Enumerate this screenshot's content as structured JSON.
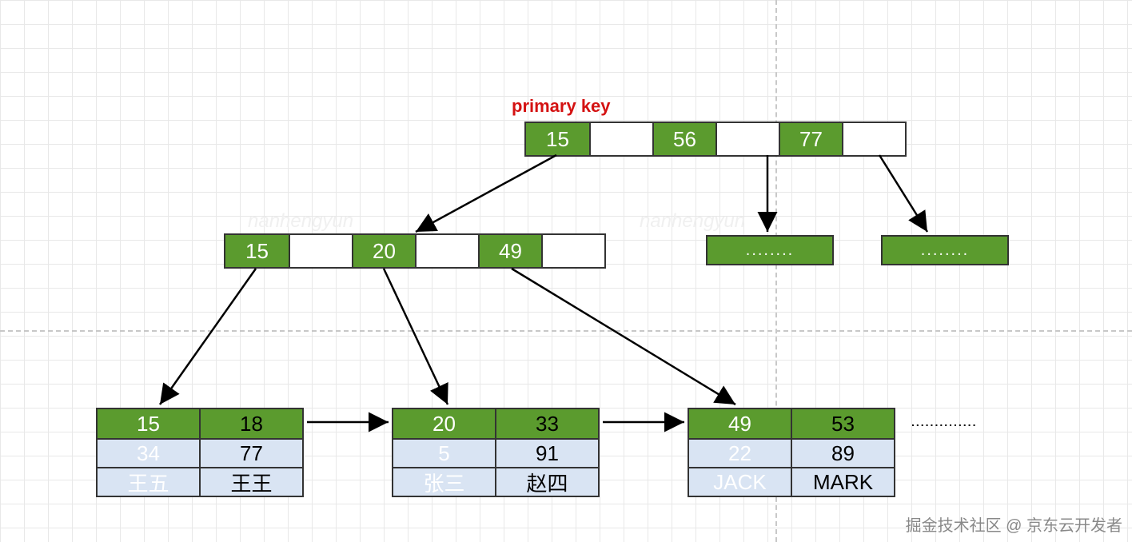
{
  "title": "primary key",
  "root": {
    "cells": [
      "15",
      "",
      "56",
      "",
      "77",
      ""
    ]
  },
  "mid": {
    "cells": [
      "15",
      "",
      "20",
      "",
      "49",
      ""
    ]
  },
  "placeholders": [
    "........",
    "........"
  ],
  "leaves": [
    {
      "head": [
        "15",
        "18"
      ],
      "row1": [
        "34",
        "77"
      ],
      "row2": [
        "王五",
        "王王"
      ]
    },
    {
      "head": [
        "20",
        "33"
      ],
      "row1": [
        "5",
        "91"
      ],
      "row2": [
        "张三",
        "赵四"
      ]
    },
    {
      "head": [
        "49",
        "53"
      ],
      "row1": [
        "22",
        "89"
      ],
      "row2": [
        "JACK",
        "MARK"
      ]
    }
  ],
  "trailing_dots": "..............",
  "watermark": "nanhengyun",
  "credit": "掘金技术社区 @ 京东云开发者"
}
